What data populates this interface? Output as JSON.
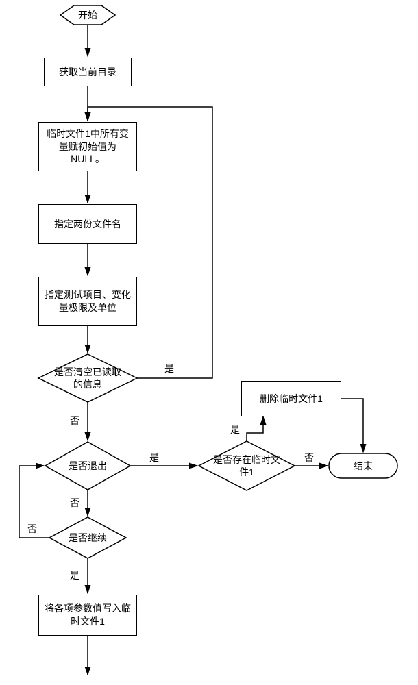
{
  "nodes": {
    "start": "开始",
    "getDir": "获取当前目录",
    "initNull": "临时文件1中所有变量赋初始值为NULL。",
    "specifyFiles": "指定两份文件名",
    "specifyItems": "指定测试项目、变化量极限及单位",
    "clearRead": "是否清空已读取的信息",
    "exit": "是否退出",
    "continue": "是否继续",
    "writeParams": "将各项参数值写入临时文件1",
    "tempExists": "是否存在临时文件1",
    "deleteTemp": "删除临时文件1",
    "end": "结束"
  },
  "labels": {
    "yes": "是",
    "no": "否"
  }
}
